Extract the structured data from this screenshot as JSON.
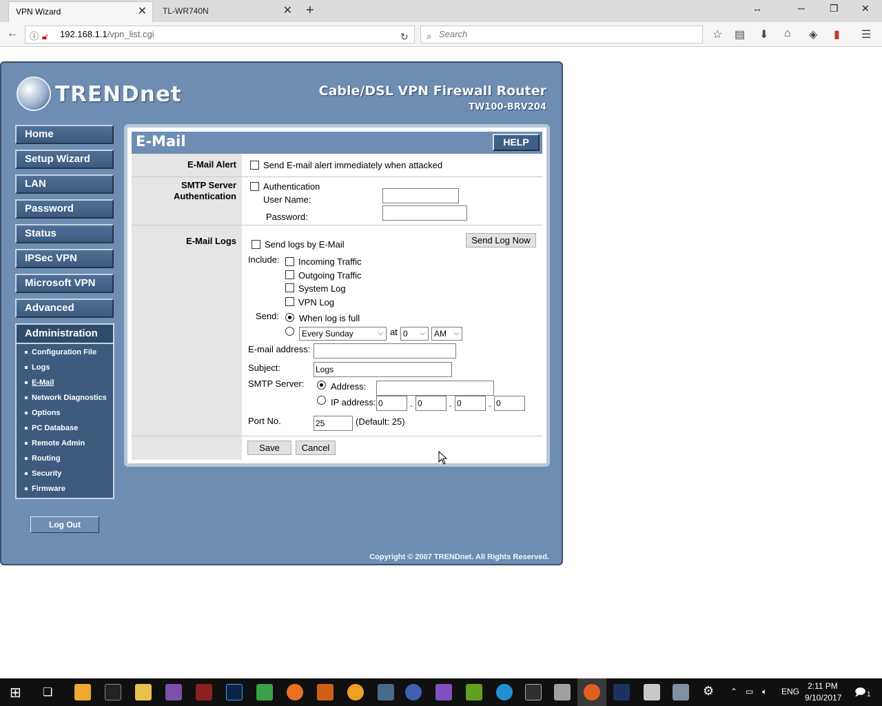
{
  "browser": {
    "tabs": [
      {
        "label": "VPN Wizard",
        "active": true
      },
      {
        "label": "TL-WR740N",
        "active": false
      }
    ],
    "url_host": "192.168.1.1",
    "url_path": "/vpn_list.cgi",
    "search_placeholder": "Search"
  },
  "router": {
    "brand": "TRENDnet",
    "product_title": "Cable/DSL VPN Firewall Router",
    "model": "TW100-BRV204",
    "copyright": "Copyright © 2007 TRENDnet. All Rights Reserved.",
    "logout_label": "Log Out"
  },
  "menu": {
    "items": [
      "Home",
      "Setup Wizard",
      "LAN",
      "Password",
      "Status",
      "IPSec VPN",
      "Microsoft VPN",
      "Advanced"
    ],
    "admin_label": "Administration",
    "admin_items": [
      "Configuration File",
      "Logs",
      "E-Mail",
      "Network Diagnostics",
      "Options",
      "PC Database",
      "Remote Admin",
      "Routing",
      "Security",
      "Firmware"
    ],
    "current": "E-Mail"
  },
  "email_page": {
    "title": "E-Mail",
    "help_label": "HELP",
    "alert": {
      "label": "E-Mail Alert",
      "checkbox_label": "Send E-mail alert immediately when attacked",
      "checked": false
    },
    "smtp_auth": {
      "label_line1": "SMTP Server",
      "label_line2": "Authentication",
      "checkbox_label": "Authentication",
      "checked": false,
      "username_label": "User Name:",
      "username_value": "",
      "password_label": "Password:",
      "password_value": ""
    },
    "logs": {
      "label": "E-Mail Logs",
      "send_logs_label": "Send logs by E-Mail",
      "send_logs_checked": false,
      "send_now_label": "Send Log Now",
      "include_label": "Include:",
      "include_options": [
        {
          "label": "Incoming Traffic",
          "checked": false
        },
        {
          "label": "Outgoing Traffic",
          "checked": false
        },
        {
          "label": "System Log",
          "checked": false
        },
        {
          "label": "VPN Log",
          "checked": false
        }
      ],
      "send_label": "Send:",
      "when_full_label": "When log is full",
      "when_full_selected": true,
      "schedule_day": "Every Sunday",
      "at_label": "at",
      "schedule_hour": "0",
      "schedule_ampm": "AM",
      "email_address_label": "E-mail address:",
      "email_address_value": "",
      "subject_label": "Subject:",
      "subject_value": "Logs",
      "smtp_server_label": "SMTP Server:",
      "address_label": "Address:",
      "address_selected": true,
      "address_value": "",
      "ip_label": "IP address:",
      "ip_octets": [
        "0",
        "0",
        "0",
        "0"
      ],
      "ip_dot": ".",
      "port_label": "Port No.",
      "port_value": "25",
      "port_default": "(Default: 25)"
    },
    "save_label": "Save",
    "cancel_label": "Cancel"
  },
  "taskbar": {
    "time": "2:11 PM",
    "date": "9/10/2017",
    "language": "ENG",
    "notification_count": "1"
  }
}
